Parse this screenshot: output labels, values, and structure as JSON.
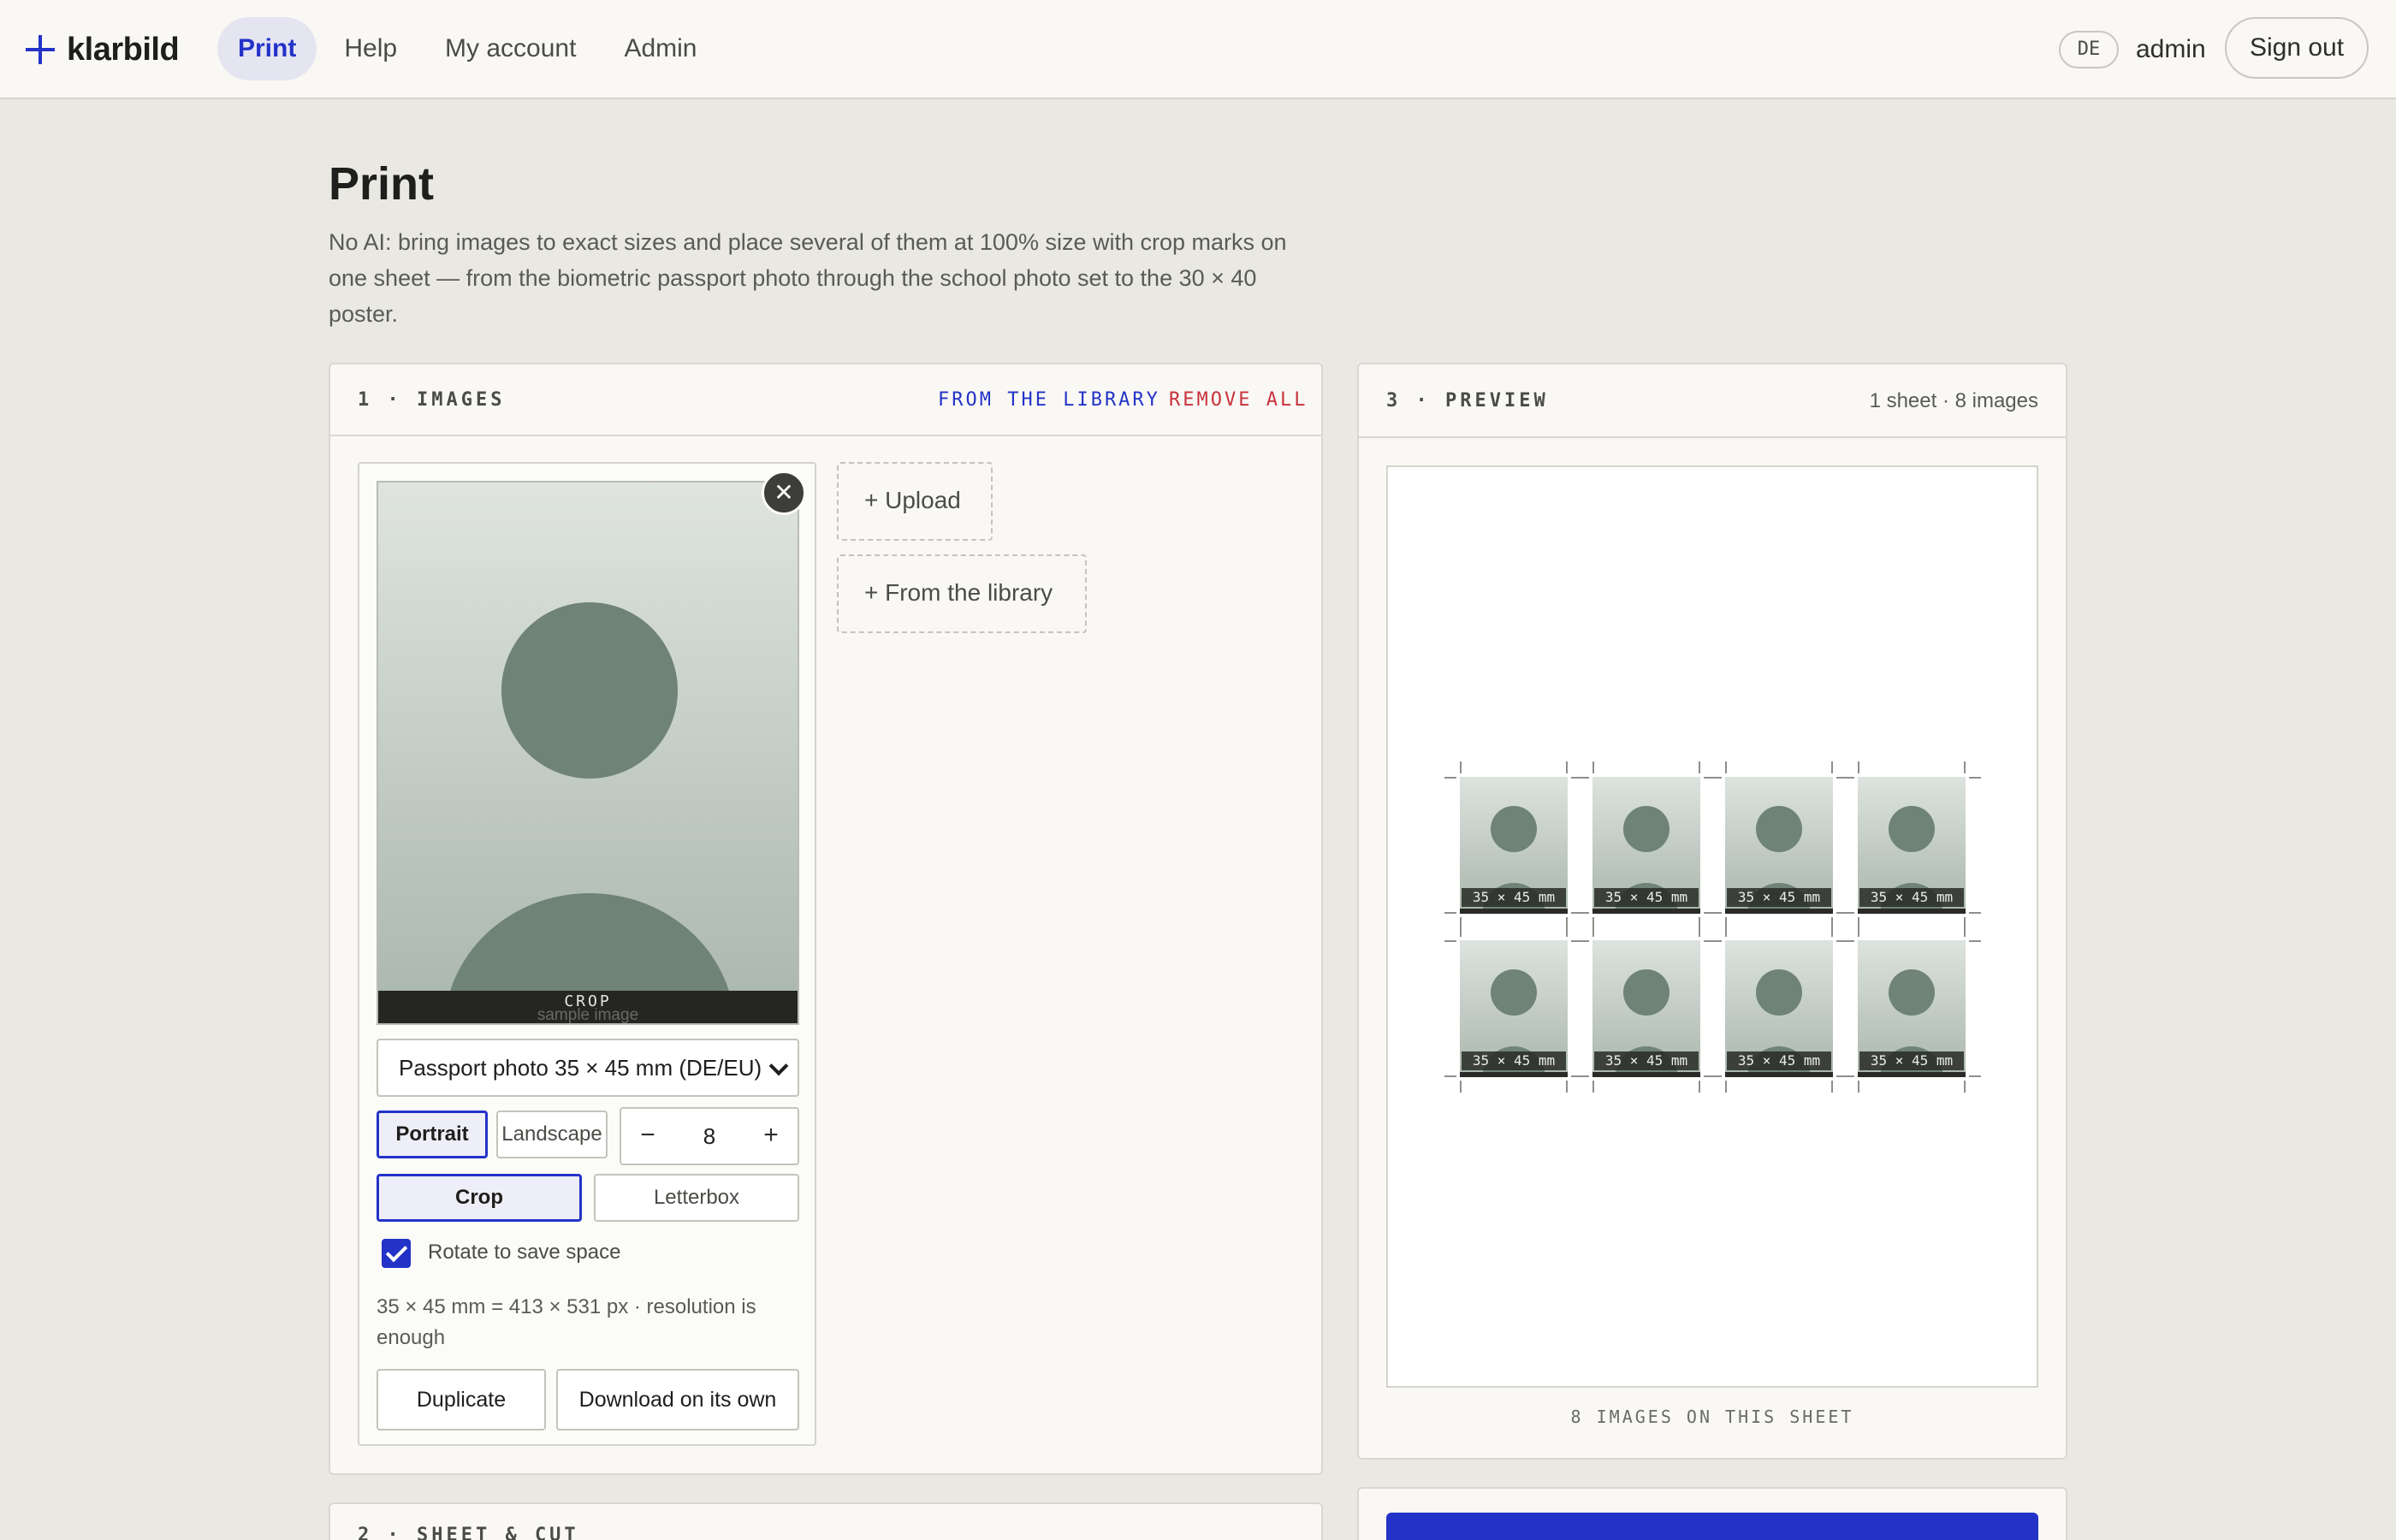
{
  "app": {
    "name": "klarbild",
    "colors": {
      "accent": "#2333c8",
      "danger": "#c8323c"
    }
  },
  "nav": {
    "items": [
      {
        "label": "Print",
        "active": true
      },
      {
        "label": "Help"
      },
      {
        "label": "My account"
      },
      {
        "label": "Admin"
      }
    ]
  },
  "header": {
    "language": "DE",
    "user": "admin",
    "sign_out": "Sign out"
  },
  "page": {
    "title": "Print",
    "description": "No AI: bring images to exact sizes and place several of them at 100% size with crop marks on one sheet — from the biometric passport photo through the school photo set to the 30 × 40 poster."
  },
  "images_panel": {
    "title": "1 · IMAGES",
    "from_library": "FROM THE LIBRARY",
    "remove_all": "REMOVE ALL",
    "card": {
      "close_icon": "close-icon",
      "crop_label": "CROP",
      "sample_label": "sample image",
      "format": "Passport photo 35 × 45 mm (DE/EU)",
      "orientation": {
        "portrait": "Portrait",
        "landscape": "Landscape",
        "selected": "Portrait"
      },
      "quantity": {
        "minus": "−",
        "value": "8",
        "plus": "+"
      },
      "fit": {
        "crop": "Crop",
        "letterbox": "Letterbox",
        "selected": "Crop"
      },
      "rotate": {
        "label": "Rotate to save space",
        "checked": true
      },
      "info": "35 × 45 mm = 413 × 531 px · resolution is enough",
      "duplicate": "Duplicate",
      "download": "Download on its own"
    },
    "upload": "+ Upload",
    "library": "+ From the library"
  },
  "sheet_panel": {
    "title": "2 · SHEET & CUT"
  },
  "preview_panel": {
    "title": "3 · PREVIEW",
    "summary": "1 sheet · 8 images",
    "photo_label": "35 × 45 mm",
    "rows": 2,
    "cols": 4,
    "footer": "8 IMAGES ON THIS SHEET"
  }
}
